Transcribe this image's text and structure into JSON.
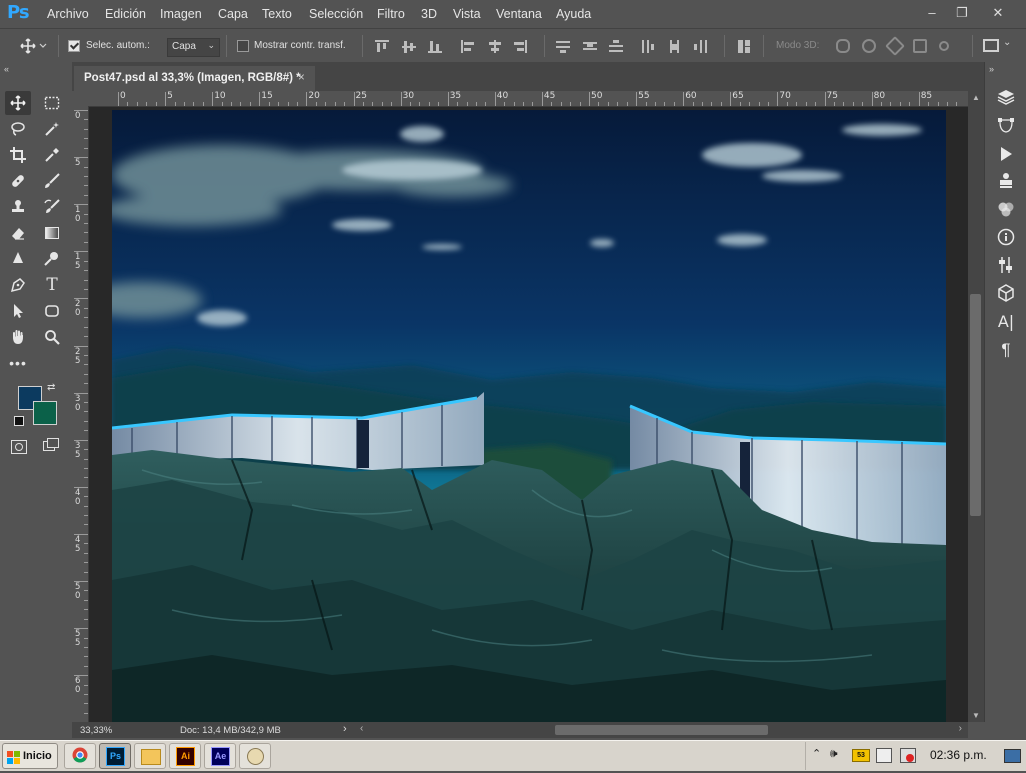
{
  "app": {
    "logo": "Ps",
    "window_buttons": [
      "–",
      "❐",
      "✕"
    ]
  },
  "menu": [
    "Archivo",
    "Edición",
    "Imagen",
    "Capa",
    "Texto",
    "Selección",
    "Filtro",
    "3D",
    "Vista",
    "Ventana",
    "Ayuda"
  ],
  "options": {
    "auto_select_label": "Selec. autom.:",
    "auto_select_checked": true,
    "auto_select_target": "Capa",
    "show_transform_label": "Mostrar contr. transf.",
    "show_transform_checked": false,
    "mode_3d_label": "Modo 3D:"
  },
  "document": {
    "tab_title": "Post47.psd al 33,3% (Imagen, RGB/8#) *",
    "close_glyph": "×",
    "zoom": "33,33%",
    "doc_size": "Doc: 13,4 MB/342,9 MB"
  },
  "rulers": {
    "h_labels": [
      "0",
      "5",
      "10",
      "15",
      "20",
      "25",
      "30",
      "35",
      "40",
      "45",
      "50",
      "55",
      "60",
      "65",
      "70",
      "75",
      "80",
      "85"
    ],
    "v_labels": [
      "0",
      "5",
      "10",
      "15",
      "20",
      "25",
      "30",
      "35",
      "40",
      "45",
      "50",
      "55",
      "60"
    ]
  },
  "colors": {
    "foreground": "#0c3a5f",
    "background": "#0b6149",
    "accent": "#31a8ff"
  },
  "tools": [
    "move-tool",
    "marquee-tool",
    "lasso-tool",
    "magic-wand-tool",
    "crop-tool",
    "eyedropper-tool",
    "healing-brush-tool",
    "brush-tool",
    "clone-stamp-tool",
    "history-brush-tool",
    "eraser-tool",
    "gradient-tool",
    "blur-tool",
    "dodge-tool",
    "pen-tool",
    "type-tool",
    "path-selection-tool",
    "shape-tool",
    "hand-tool",
    "zoom-tool",
    "edit-toolbar",
    "quick-mask",
    "screen-mode"
  ],
  "panels": [
    "layers-icon",
    "paths-icon",
    "actions-icon",
    "properties-icon",
    "channels-icon",
    "info-icon",
    "adjustments-icon",
    "3d-icon",
    "character-icon",
    "paragraph-icon"
  ],
  "taskbar": {
    "start_label": "Inicio",
    "apps": [
      "chrome",
      "photoshop",
      "explorer",
      "illustrator",
      "after-effects",
      "paint"
    ],
    "clock": "02:36 p.m."
  }
}
